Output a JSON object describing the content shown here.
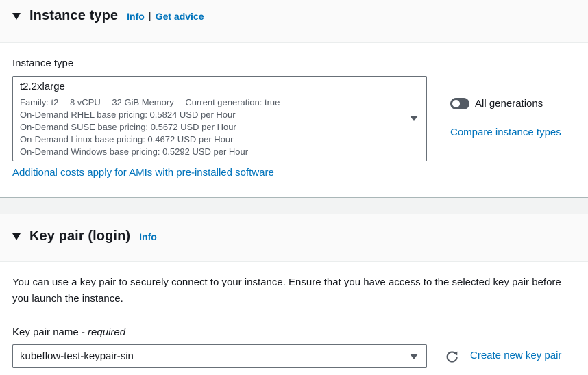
{
  "instance_type_section": {
    "title": "Instance type",
    "info": "Info",
    "separator": "|",
    "get_advice": "Get advice",
    "field_label": "Instance type",
    "selected": {
      "name": "t2.2xlarge",
      "family": "Family: t2",
      "vcpu": "8 vCPU",
      "memory": "32 GiB Memory",
      "generation": "Current generation: true",
      "pricing_rhel": "On-Demand RHEL base pricing: 0.5824 USD per Hour",
      "pricing_suse": "On-Demand SUSE base pricing: 0.5672 USD per Hour",
      "pricing_linux": "On-Demand Linux base pricing: 0.4672 USD per Hour",
      "pricing_windows": "On-Demand Windows base pricing: 0.5292 USD per Hour"
    },
    "toggle_label": "All generations",
    "toggle_on": false,
    "compare_link": "Compare instance types",
    "additional_costs_link": "Additional costs apply for AMIs with pre-installed software"
  },
  "key_pair_section": {
    "title": "Key pair (login)",
    "info": "Info",
    "description": "You can use a key pair to securely connect to your instance. Ensure that you have access to the selected key pair before you launch the instance.",
    "field_label": "Key pair name - ",
    "field_required": "required",
    "selected": "kubeflow-test-keypair-sin",
    "create_link": "Create new key pair"
  },
  "colors": {
    "link": "#0073bb",
    "text": "#16191f",
    "muted": "#545b64",
    "toggle_off": "#545b64"
  },
  "icons": {
    "collapse": "caret-down-icon",
    "dropdown": "triangle-down-icon",
    "refresh": "refresh-icon"
  }
}
